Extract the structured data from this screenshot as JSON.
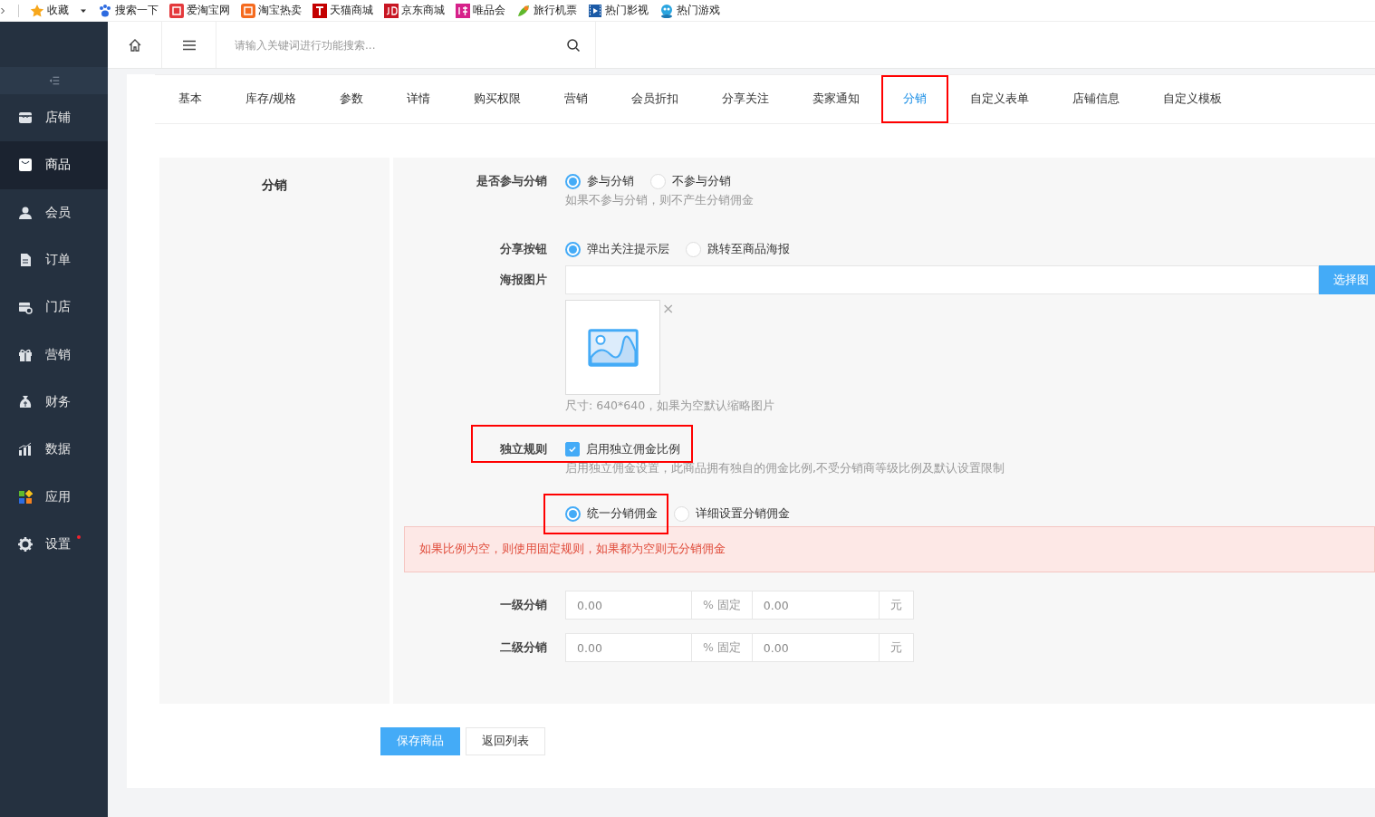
{
  "bookmarks": [
    {
      "label": "收藏",
      "kind": "star",
      "dropdown": true
    },
    {
      "label": "搜索一下",
      "kind": "paw"
    },
    {
      "label": "爱淘宝网",
      "kind": "tao"
    },
    {
      "label": "淘宝热卖",
      "kind": "tao2"
    },
    {
      "label": "天猫商城",
      "kind": "t"
    },
    {
      "label": "京东商城",
      "kind": "jd"
    },
    {
      "label": "唯品会",
      "kind": "te"
    },
    {
      "label": "旅行机票",
      "kind": "leaf"
    },
    {
      "label": "热门影视",
      "kind": "film"
    },
    {
      "label": "热门游戏",
      "kind": "game"
    }
  ],
  "sidebar": {
    "items": [
      {
        "label": "店铺",
        "kind": "store",
        "selected": false,
        "dot": false
      },
      {
        "label": "商品",
        "kind": "bag",
        "selected": true,
        "dot": false
      },
      {
        "label": "会员",
        "kind": "user",
        "selected": false,
        "dot": false
      },
      {
        "label": "订单",
        "kind": "doc",
        "selected": false,
        "dot": false
      },
      {
        "label": "门店",
        "kind": "shop",
        "selected": false,
        "dot": false
      },
      {
        "label": "营销",
        "kind": "gift",
        "selected": false,
        "dot": false
      },
      {
        "label": "财务",
        "kind": "money",
        "selected": false,
        "dot": false
      },
      {
        "label": "数据",
        "kind": "chart",
        "selected": false,
        "dot": false
      },
      {
        "label": "应用",
        "kind": "apps",
        "selected": false,
        "dot": false
      },
      {
        "label": "设置",
        "kind": "gear",
        "selected": false,
        "dot": true
      }
    ]
  },
  "header": {
    "search": {
      "placeholder": "请输入关键词进行功能搜索..."
    }
  },
  "tabs": [
    {
      "label": "基本",
      "selected": false,
      "highlighted": false
    },
    {
      "label": "库存/规格",
      "selected": false,
      "highlighted": false
    },
    {
      "label": "参数",
      "selected": false,
      "highlighted": false
    },
    {
      "label": "详情",
      "selected": false,
      "highlighted": false
    },
    {
      "label": "购买权限",
      "selected": false,
      "highlighted": false
    },
    {
      "label": "营销",
      "selected": false,
      "highlighted": false
    },
    {
      "label": "会员折扣",
      "selected": false,
      "highlighted": false
    },
    {
      "label": "分享关注",
      "selected": false,
      "highlighted": false
    },
    {
      "label": "卖家通知",
      "selected": false,
      "highlighted": false
    },
    {
      "label": "分销",
      "selected": true,
      "highlighted": true
    },
    {
      "label": "自定义表单",
      "selected": false,
      "highlighted": false
    },
    {
      "label": "店铺信息",
      "selected": false,
      "highlighted": false
    },
    {
      "label": "自定义模板",
      "selected": false,
      "highlighted": false
    }
  ],
  "section": {
    "title": "分销"
  },
  "form": {
    "participate": {
      "label": "是否参与分销",
      "options": [
        {
          "label": "参与分销",
          "selected": true
        },
        {
          "label": "不参与分销",
          "selected": false
        }
      ],
      "help": "如果不参与分销，则不产生分销佣金"
    },
    "share_button": {
      "label": "分享按钮",
      "options": [
        {
          "label": "弹出关注提示层",
          "selected": true
        },
        {
          "label": "跳转至商品海报",
          "selected": false
        }
      ]
    },
    "poster": {
      "label": "海报图片",
      "button": "选择图",
      "remove": "×",
      "help": "尺寸: 640*640，如果为空默认缩略图片"
    },
    "rule": {
      "label": "独立规则",
      "checkbox": {
        "label": "启用独立佣金比例",
        "checked": true
      },
      "highlighted": true,
      "help": "启用独立佣金设置，此商品拥有独自的佣金比例,不受分销商等级比例及默认设置限制"
    },
    "mode": {
      "options": [
        {
          "label": "统一分销佣金",
          "selected": true,
          "highlighted": true
        },
        {
          "label": "详细设置分销佣金",
          "selected": false,
          "highlighted": false
        }
      ]
    },
    "alert": "如果比例为空，则使用固定规则，如果都为空则无分销佣金",
    "levels": [
      {
        "label": "一级分销",
        "percent": "0.00",
        "percent_unit": "% 固定",
        "fixed": "0.00",
        "fixed_unit": "元"
      },
      {
        "label": "二级分销",
        "percent": "0.00",
        "percent_unit": "% 固定",
        "fixed": "0.00",
        "fixed_unit": "元"
      }
    ]
  },
  "actions": [
    {
      "label": "保存商品",
      "kind": "primary"
    },
    {
      "label": "返回列表",
      "kind": "default"
    }
  ]
}
